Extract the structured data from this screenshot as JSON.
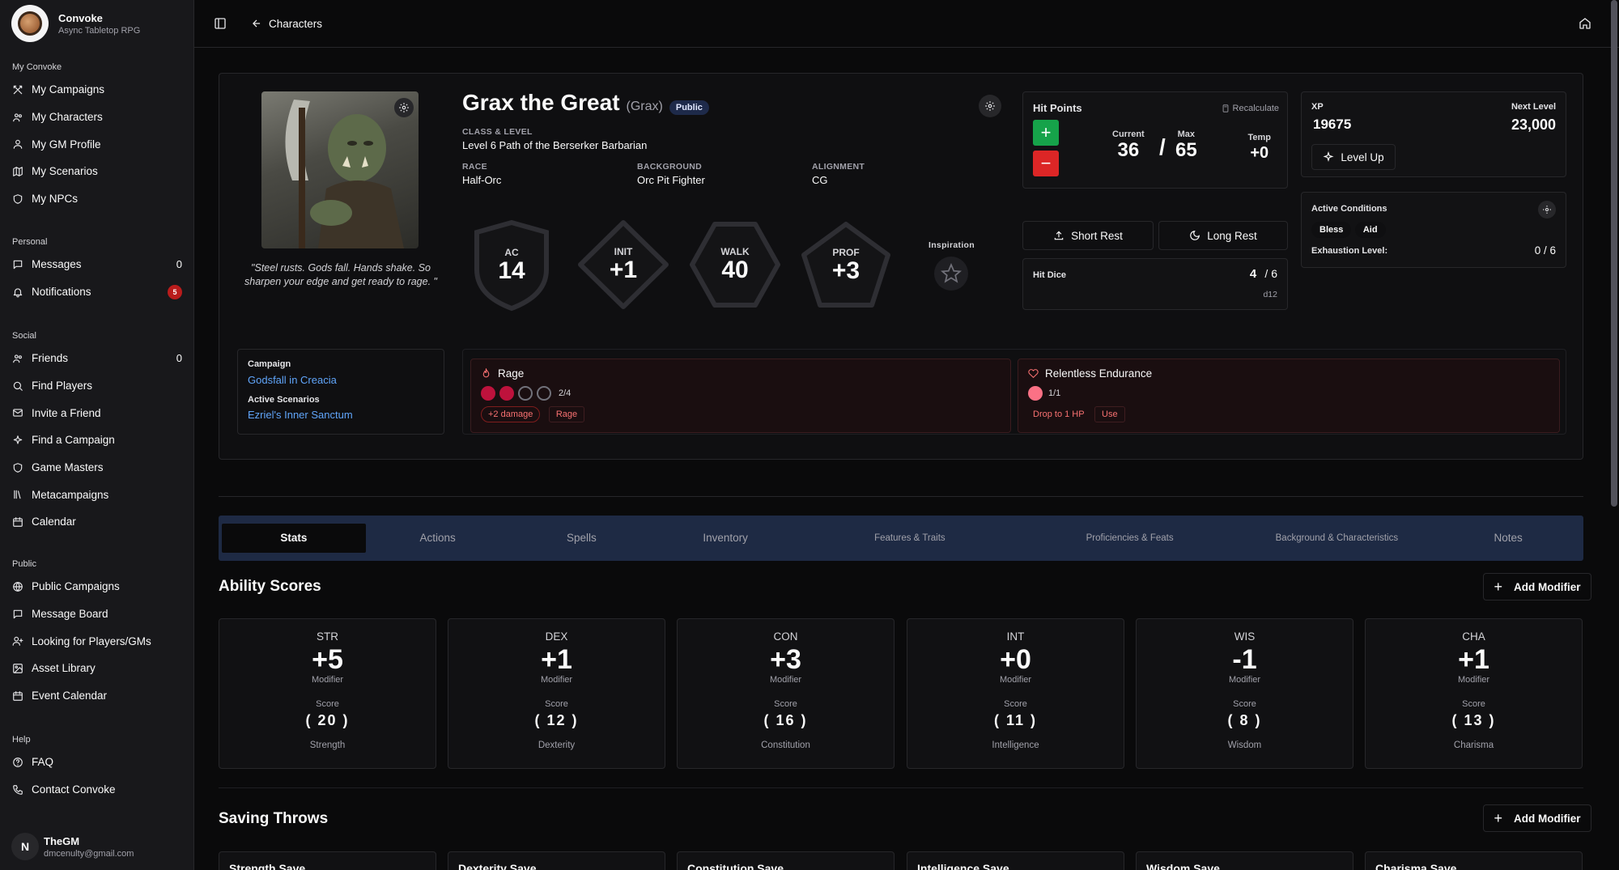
{
  "app": {
    "name": "Convoke",
    "subtitle": "Async Tabletop RPG"
  },
  "sidebar": {
    "sections": [
      {
        "title": "My Convoke",
        "items": [
          {
            "label": "My Campaigns",
            "icon": "swords-icon"
          },
          {
            "label": "My Characters",
            "icon": "users-icon"
          },
          {
            "label": "My GM Profile",
            "icon": "user-icon"
          },
          {
            "label": "My Scenarios",
            "icon": "map-icon"
          },
          {
            "label": "My NPCs",
            "icon": "shield-icon"
          }
        ]
      },
      {
        "title": "Personal",
        "items": [
          {
            "label": "Messages",
            "icon": "message-icon",
            "count": "0"
          },
          {
            "label": "Notifications",
            "icon": "bell-icon",
            "badge": "5"
          }
        ]
      },
      {
        "title": "Social",
        "items": [
          {
            "label": "Friends",
            "icon": "users-icon",
            "count": "0"
          },
          {
            "label": "Find Players",
            "icon": "search-icon"
          },
          {
            "label": "Invite a Friend",
            "icon": "mail-icon"
          },
          {
            "label": "Find a Campaign",
            "icon": "sparkles-icon"
          },
          {
            "label": "Game Masters",
            "icon": "shield-icon"
          },
          {
            "label": "Metacampaigns",
            "icon": "library-icon"
          },
          {
            "label": "Calendar",
            "icon": "calendar-icon"
          }
        ]
      },
      {
        "title": "Public",
        "items": [
          {
            "label": "Public Campaigns",
            "icon": "globe-icon"
          },
          {
            "label": "Message Board",
            "icon": "message-icon"
          },
          {
            "label": "Looking for Players/GMs",
            "icon": "user-plus-icon"
          },
          {
            "label": "Asset Library",
            "icon": "image-icon"
          },
          {
            "label": "Event Calendar",
            "icon": "calendar-icon"
          }
        ]
      },
      {
        "title": "Help",
        "items": [
          {
            "label": "FAQ",
            "icon": "help-circle-icon"
          },
          {
            "label": "Contact Convoke",
            "icon": "phone-icon"
          }
        ]
      }
    ],
    "user": {
      "initial": "N",
      "name": "TheGM",
      "email": "dmcenulty@gmail.com"
    }
  },
  "topbar": {
    "back_label": "Characters"
  },
  "character": {
    "name": "Grax the Great",
    "nickname": "(Grax)",
    "visibility": "Public",
    "quote": "\"Steel rusts. Gods fall. Hands shake. So sharpen your edge and get ready to rage. \"",
    "class_label": "CLASS & LEVEL",
    "class_value": "Level 6 Path of the Berserker Barbarian",
    "race_label": "RACE",
    "race_value": "Half-Orc",
    "background_label": "BACKGROUND",
    "background_value": "Orc Pit Fighter",
    "alignment_label": "ALIGNMENT",
    "alignment_value": "CG",
    "stats": [
      {
        "label": "AC",
        "value": "14"
      },
      {
        "label": "INIT",
        "value": "+1"
      },
      {
        "label": "WALK",
        "value": "40"
      },
      {
        "label": "PROF",
        "value": "+3"
      }
    ],
    "inspiration_label": "Inspiration"
  },
  "hp": {
    "title": "Hit Points",
    "recalculate": "Recalculate",
    "current_label": "Current",
    "current": "36",
    "sep": "/",
    "max_label": "Max",
    "max": "65",
    "temp_label": "Temp",
    "temp": "+0",
    "plus": "+",
    "minus": "−"
  },
  "rest": {
    "short": "Short Rest",
    "long": "Long Rest"
  },
  "hit_dice": {
    "label": "Hit Dice",
    "value": "4",
    "total": "/ 6",
    "die": "d12"
  },
  "xp": {
    "label": "XP",
    "value": "19675",
    "next_label": "Next Level",
    "next": "23,000",
    "level_up": "Level Up"
  },
  "conditions": {
    "title": "Active Conditions",
    "items": [
      "Bless",
      "Aid"
    ],
    "exhaustion_label": "Exhaustion Level:",
    "exhaustion_value": "0 / 6"
  },
  "campaign": {
    "label": "Campaign",
    "name": "Godsfall in Creacia",
    "scenarios_label": "Active Scenarios",
    "scenario": "Ezriel's Inner Sanctum"
  },
  "features": [
    {
      "name": "Rage",
      "count": "2/4",
      "used": 2,
      "total": 4,
      "tags": [
        "+2 damage",
        "Rage"
      ]
    },
    {
      "name": "Relentless Endurance",
      "count": "1/1",
      "used": 1,
      "total": 1,
      "tags": [
        "Drop to 1 HP",
        "Use"
      ]
    }
  ],
  "tabs": [
    "Stats",
    "Actions",
    "Spells",
    "Inventory",
    "Features & Traits",
    "Proficiencies & Feats",
    "Background & Characteristics",
    "Notes"
  ],
  "ability_section": {
    "title": "Ability Scores",
    "add_modifier": "Add Modifier",
    "modifier_label": "Modifier",
    "score_label": "Score"
  },
  "abilities": [
    {
      "abbr": "STR",
      "mod": "+5",
      "score": "( 20 )",
      "full": "Strength"
    },
    {
      "abbr": "DEX",
      "mod": "+1",
      "score": "( 12 )",
      "full": "Dexterity"
    },
    {
      "abbr": "CON",
      "mod": "+3",
      "score": "( 16 )",
      "full": "Constitution"
    },
    {
      "abbr": "INT",
      "mod": "+0",
      "score": "( 11 )",
      "full": "Intelligence"
    },
    {
      "abbr": "WIS",
      "mod": "-1",
      "score": "( 8 )",
      "full": "Wisdom"
    },
    {
      "abbr": "CHA",
      "mod": "+1",
      "score": "( 13 )",
      "full": "Charisma"
    }
  ],
  "saving_section": {
    "title": "Saving Throws",
    "add_modifier": "Add Modifier"
  },
  "saves": [
    "Strength Save",
    "Dexterity Save",
    "Constitution Save",
    "Intelligence Save",
    "Wisdom Save",
    "Charisma Save"
  ],
  "colors": {
    "accent_tab_bar": "#1e2a44",
    "hp_plus": "#16a34a",
    "hp_minus": "#dc2626",
    "feature_red": "#be123c",
    "link": "#60a5fa"
  }
}
